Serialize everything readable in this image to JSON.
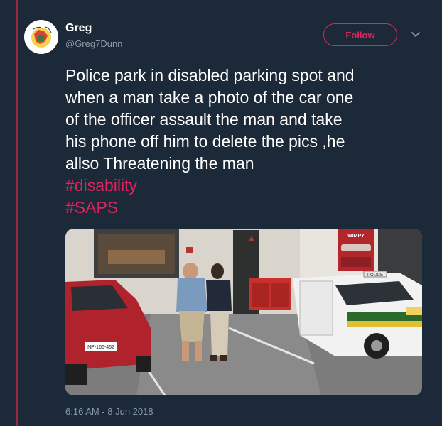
{
  "user": {
    "name": "Greg",
    "handle": "@Greg7Dunn"
  },
  "header": {
    "follow_label": "Follow",
    "caret_icon": "chevron-down-icon"
  },
  "tweet": {
    "lines": [
      "Police park in disabled parking spot and",
      "when a man take a photo of the car one",
      "of the officer assault the man and take",
      "his phone off him to delete the pics ,he",
      "allso Threatening the man"
    ],
    "hashtags": [
      "#disability",
      "#SAPS"
    ],
    "timestamp": "6:16 AM - 8 Jun 2018"
  },
  "media": {
    "store_sign": "WIMPY",
    "police_label": "POLICE",
    "license_plate": "NP-166-462"
  },
  "colors": {
    "background": "#1c2938",
    "accent": "#e0245e",
    "thread_line": "#9b2740",
    "muted_text": "#8899a6"
  }
}
